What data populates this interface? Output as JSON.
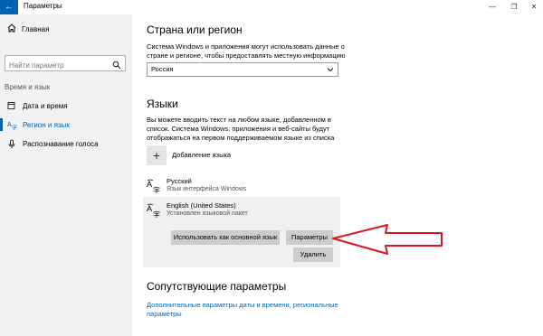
{
  "window": {
    "title": "Параметры"
  },
  "sidebar": {
    "home": "Главная",
    "search_placeholder": "Найти параметр",
    "section": "Время и язык",
    "items": [
      {
        "label": "Дата и время",
        "icon": "calendar-clock-icon"
      },
      {
        "label": "Регион и язык",
        "icon": "region-language-icon",
        "active": true
      },
      {
        "label": "Распознавание голоса",
        "icon": "microphone-icon"
      }
    ]
  },
  "main": {
    "country_title": "Страна или регион",
    "country_desc_line1": "Система Windows и приложения могут использовать данные о",
    "country_desc_line2": "стране и регионе, чтобы предоставлять местную информацию",
    "country_value": "Россия",
    "languages_title": "Языки",
    "languages_desc_line1": "Вы можете вводить текст на любом языке, добавленном в",
    "languages_desc_line2": "список. Система Windows, приложения и веб-сайты будут",
    "languages_desc_line3": "отображаться на первом поддерживаемом языке из списка",
    "add_language": "Добавление языка",
    "languages": [
      {
        "name": "Русский",
        "status": "Язык интерфейса Windows"
      },
      {
        "name": "English (United States)",
        "status": "Установлен языковой пакет"
      }
    ],
    "buttons": {
      "set_default": "Использовать как основной язык",
      "options": "Параметры",
      "remove": "Удалить"
    },
    "related_title": "Сопутствующие параметры",
    "related_link_line1": "Дополнительные параметры даты и времени, региональные",
    "related_link_line2": "параметры"
  },
  "colors": {
    "accent": "#0063b1",
    "sidebar_bg": "#f2f2f2",
    "arrow": "#e0141e"
  }
}
